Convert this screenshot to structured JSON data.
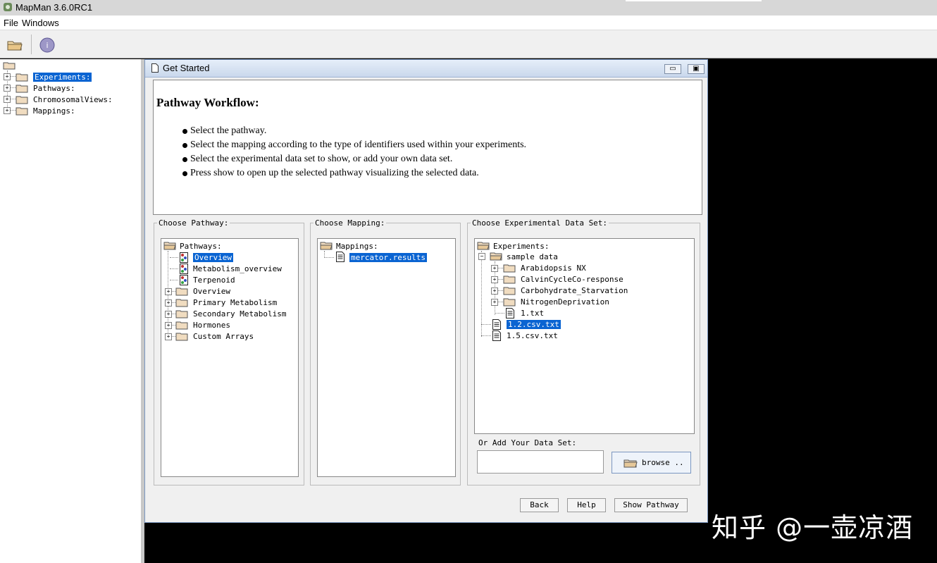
{
  "app": {
    "title": "MapMan 3.6.0RC1"
  },
  "menu": [
    "File",
    "Windows"
  ],
  "left_tree": {
    "items": [
      {
        "label": "Experiments:",
        "selected": true
      },
      {
        "label": "Pathways:"
      },
      {
        "label": "ChromosomalViews:"
      },
      {
        "label": "Mappings:"
      }
    ]
  },
  "window": {
    "title": "Get Started"
  },
  "workflow": {
    "heading": "Pathway Workflow:",
    "steps": [
      "Select the pathway.",
      "Select the mapping according to the type of identifiers used within your experiments.",
      "Select the experimental data set to show, or add your own data set.",
      "Press show to open up the selected pathway visualizing the selected data."
    ]
  },
  "pathway_panel": {
    "label": "Choose Pathway:",
    "root": "Pathways:",
    "items": [
      {
        "label": "Overview",
        "kind": "pathway",
        "selected": true
      },
      {
        "label": "Metabolism_overview",
        "kind": "pathway"
      },
      {
        "label": "Terpenoid",
        "kind": "pathway"
      },
      {
        "label": "Overview",
        "kind": "folder"
      },
      {
        "label": "Primary Metabolism",
        "kind": "folder"
      },
      {
        "label": "Secondary Metabolism",
        "kind": "folder"
      },
      {
        "label": "Hormones",
        "kind": "folder"
      },
      {
        "label": "Custom Arrays",
        "kind": "folder"
      }
    ]
  },
  "mapping_panel": {
    "label": "Choose Mapping:",
    "root": "Mappings:",
    "items": [
      {
        "label": "mercator.results",
        "selected": true
      }
    ]
  },
  "dataset_panel": {
    "label": "Choose Experimental Data Set:",
    "root": "Experiments:",
    "sample_folder": "sample data",
    "sample_items": [
      {
        "label": "Arabidopsis NX",
        "kind": "folder"
      },
      {
        "label": "CalvinCycleCo-response",
        "kind": "folder"
      },
      {
        "label": "Carbohydrate_Starvation",
        "kind": "folder"
      },
      {
        "label": "NitrogenDeprivation",
        "kind": "folder"
      },
      {
        "label": "1.txt",
        "kind": "file"
      }
    ],
    "files": [
      {
        "label": "1.2.csv.txt",
        "selected": true
      },
      {
        "label": "1.5.csv.txt"
      }
    ],
    "add_label": "Or Add Your Data Set:",
    "add_value": "",
    "browse_label": "browse .."
  },
  "buttons": {
    "back": "Back",
    "help": "Help",
    "show": "Show Pathway"
  },
  "watermark": "知乎 @一壶凉酒",
  "colors": {
    "selection": "#0a64d2",
    "background": "#000000",
    "panel": "#f0f0f0"
  }
}
